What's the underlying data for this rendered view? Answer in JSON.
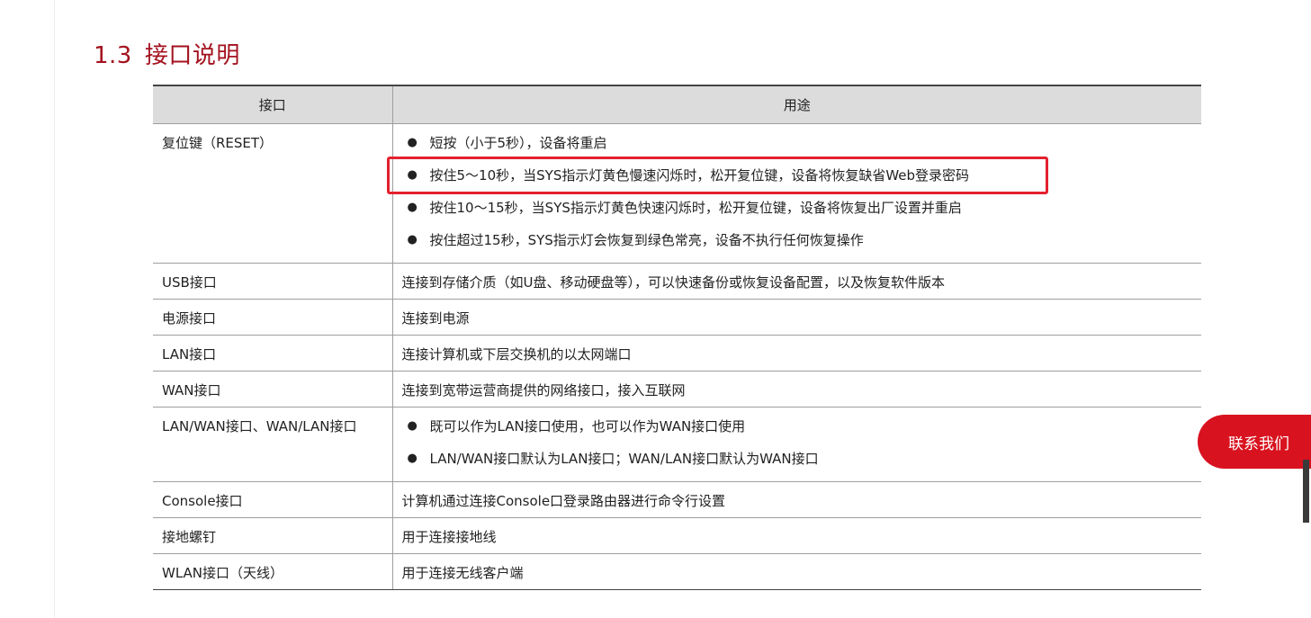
{
  "section": {
    "number": "1.3",
    "title": "接口说明"
  },
  "table": {
    "headers": [
      "接口",
      "用途"
    ],
    "rows": [
      {
        "name": "复位键（RESET）",
        "bullets": [
          "短按（小于5秒），设备将重启",
          "按住5～10秒，当SYS指示灯黄色慢速闪烁时，松开复位键，设备将恢复缺省Web登录密码",
          "按住10～15秒，当SYS指示灯黄色快速闪烁时，松开复位键，设备将恢复出厂设置并重启",
          "按住超过15秒，SYS指示灯会恢复到绿色常亮，设备不执行任何恢复操作"
        ]
      },
      {
        "name": "USB接口",
        "desc": "连接到存储介质（如U盘、移动硬盘等），可以快速备份或恢复设备配置，以及恢复软件版本"
      },
      {
        "name": "电源接口",
        "desc": "连接到电源"
      },
      {
        "name": "LAN接口",
        "desc": "连接计算机或下层交换机的以太网端口"
      },
      {
        "name": "WAN接口",
        "desc": "连接到宽带运营商提供的网络接口，接入互联网"
      },
      {
        "name": "LAN/WAN接口、WAN/LAN接口",
        "bullets": [
          "既可以作为LAN接口使用，也可以作为WAN接口使用",
          "LAN/WAN接口默认为LAN接口；WAN/LAN接口默认为WAN接口"
        ]
      },
      {
        "name": "Console接口",
        "desc": "计算机通过连接Console口登录路由器进行命令行设置"
      },
      {
        "name": "接地螺钉",
        "desc": "用于连接接地线"
      },
      {
        "name": "WLAN接口（天线）",
        "desc": "用于连接无线客户端"
      }
    ]
  },
  "contact_button": {
    "label": "联系我们"
  },
  "colors": {
    "heading": "#a3121f",
    "highlight_border": "#e4202e",
    "contact_bg": "#d9121f",
    "header_bg": "#dcdcdc"
  }
}
